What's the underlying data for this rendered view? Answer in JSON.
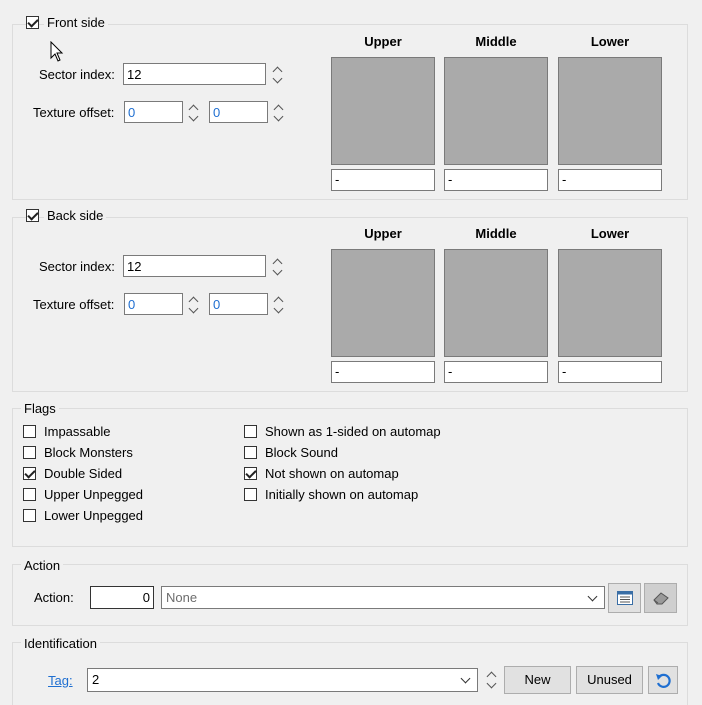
{
  "front": {
    "title": "Front side",
    "checked": true,
    "sector_label": "Sector index:",
    "sector_value": "12",
    "offset_label": "Texture offset:",
    "offset_x": "0",
    "offset_y": "0",
    "columns": [
      {
        "head": "Upper",
        "texture": "-"
      },
      {
        "head": "Middle",
        "texture": "-"
      },
      {
        "head": "Lower",
        "texture": "-"
      }
    ]
  },
  "back": {
    "title": "Back side",
    "checked": true,
    "sector_label": "Sector index:",
    "sector_value": "12",
    "offset_label": "Texture offset:",
    "offset_x": "0",
    "offset_y": "0",
    "columns": [
      {
        "head": "Upper",
        "texture": "-"
      },
      {
        "head": "Middle",
        "texture": "-"
      },
      {
        "head": "Lower",
        "texture": "-"
      }
    ]
  },
  "flags": {
    "title": "Flags",
    "left": [
      {
        "label": "Impassable",
        "checked": false
      },
      {
        "label": "Block Monsters",
        "checked": false
      },
      {
        "label": "Double Sided",
        "checked": true
      },
      {
        "label": "Upper Unpegged",
        "checked": false
      },
      {
        "label": "Lower Unpegged",
        "checked": false
      }
    ],
    "right": [
      {
        "label": "Shown as 1-sided on automap",
        "checked": false
      },
      {
        "label": "Block Sound",
        "checked": false
      },
      {
        "label": "Not shown on automap",
        "checked": true
      },
      {
        "label": "Initially shown on automap",
        "checked": false
      }
    ]
  },
  "action": {
    "title": "Action",
    "label": "Action:",
    "value": "0",
    "selected": "None",
    "browse_icon": "list-browse-icon",
    "eraser_icon": "eraser-icon"
  },
  "identification": {
    "title": "Identification",
    "tag_label": "Tag:",
    "tag_value": "2",
    "new_label": "New",
    "unused_label": "Unused",
    "undo_icon": "undo-arrow-icon"
  }
}
